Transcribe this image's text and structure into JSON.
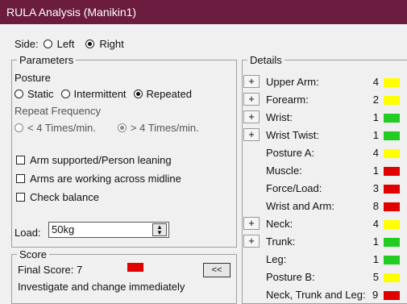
{
  "window": {
    "title": "RULA Analysis (Manikin1)"
  },
  "side": {
    "label": "Side:",
    "options": [
      {
        "label": "Left",
        "selected": false
      },
      {
        "label": "Right",
        "selected": true
      }
    ]
  },
  "parameters": {
    "title": "Parameters",
    "posture_label": "Posture",
    "posture_options": [
      {
        "label": "Static",
        "selected": false
      },
      {
        "label": "Intermittent",
        "selected": false
      },
      {
        "label": "Repeated",
        "selected": true
      }
    ],
    "repeat_label": "Repeat Frequency",
    "repeat_options": [
      {
        "label": "< 4 Times/min.",
        "selected": false
      },
      {
        "label": "> 4 Times/min.",
        "selected": true
      }
    ],
    "checks": [
      {
        "label": "Arm supported/Person leaning",
        "checked": false
      },
      {
        "label": "Arms are working across midline",
        "checked": false
      },
      {
        "label": "Check balance",
        "checked": false
      }
    ],
    "load_label": "Load:",
    "load_value": "50kg"
  },
  "score": {
    "title": "Score",
    "final_label": "Final Score: 7",
    "final_color": "#e00000",
    "message": "Investigate and change immediately",
    "toggle_label": "<<"
  },
  "details": {
    "title": "Details",
    "rows": [
      {
        "label": "Upper Arm:",
        "value": "4",
        "color": "#ffff00",
        "expandable": true
      },
      {
        "label": "Forearm:",
        "value": "2",
        "color": "#ffff00",
        "expandable": true
      },
      {
        "label": "Wrist:",
        "value": "1",
        "color": "#22cc22",
        "expandable": true
      },
      {
        "label": "Wrist Twist:",
        "value": "1",
        "color": "#22cc22",
        "expandable": true
      },
      {
        "label": "Posture A:",
        "value": "4",
        "color": "#ffff00",
        "expandable": false
      },
      {
        "label": "Muscle:",
        "value": "1",
        "color": "#e00000",
        "expandable": false
      },
      {
        "label": "Force/Load:",
        "value": "3",
        "color": "#e00000",
        "expandable": false
      },
      {
        "label": "Wrist and Arm:",
        "value": "8",
        "color": "#e00000",
        "expandable": false
      },
      {
        "label": "Neck:",
        "value": "4",
        "color": "#ffff00",
        "expandable": true
      },
      {
        "label": "Trunk:",
        "value": "1",
        "color": "#22cc22",
        "expandable": true
      },
      {
        "label": "Leg:",
        "value": "1",
        "color": "#22cc22",
        "expandable": false
      },
      {
        "label": "Posture B:",
        "value": "5",
        "color": "#ffff00",
        "expandable": false
      },
      {
        "label": "Neck, Trunk and Leg:",
        "value": "9",
        "color": "#e00000",
        "expandable": false
      }
    ]
  }
}
